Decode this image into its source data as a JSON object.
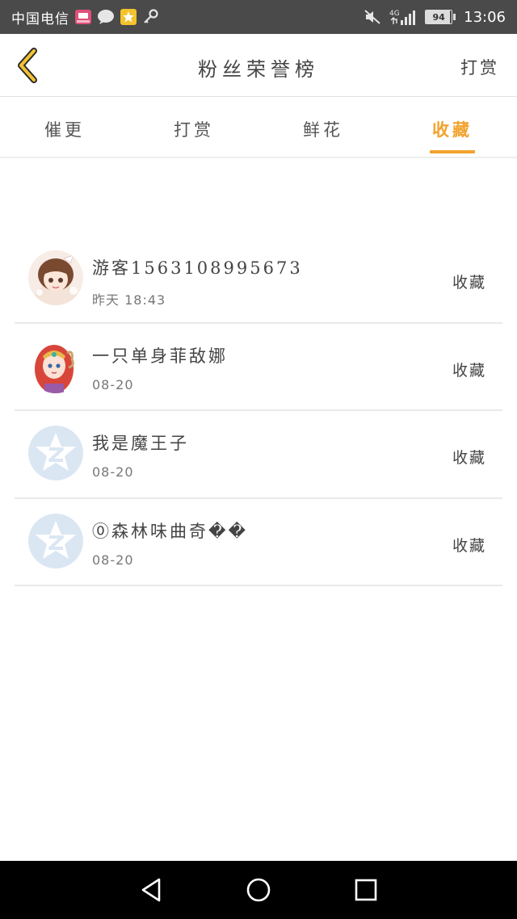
{
  "status_bar": {
    "carrier": "中国电信",
    "network": "4G",
    "battery": "94",
    "battery_level": 0.94,
    "time": "13:06",
    "icons": [
      "app-store-icon",
      "chat-bubble-icon",
      "star-app-icon",
      "key-icon",
      "mute-icon",
      "signal-icon",
      "battery-icon"
    ]
  },
  "header": {
    "title": "粉丝荣誉榜",
    "action": "打赏",
    "back_icon": "chevron-left-icon"
  },
  "tabs": [
    {
      "label": "催更",
      "active": false
    },
    {
      "label": "打赏",
      "active": false
    },
    {
      "label": "鲜花",
      "active": false
    },
    {
      "label": "收藏",
      "active": true
    }
  ],
  "accent_color": "#f2a22d",
  "fans": [
    {
      "name": "游客1563108995673",
      "time": "昨天 18:43",
      "action": "收藏",
      "avatar": "anime-girl-avatar"
    },
    {
      "name": "一只单身菲敌娜",
      "time": "08-20",
      "action": "收藏",
      "avatar": "anime-red-hair-avatar"
    },
    {
      "name": "我是魔王子",
      "time": "08-20",
      "action": "收藏",
      "avatar": "default-star-avatar"
    },
    {
      "name": "⓪森林味曲奇��",
      "time": "08-20",
      "action": "收藏",
      "avatar": "default-star-avatar"
    }
  ],
  "nav_bar": {
    "icons": [
      "back-triangle-icon",
      "home-circle-icon",
      "recents-square-icon"
    ]
  }
}
